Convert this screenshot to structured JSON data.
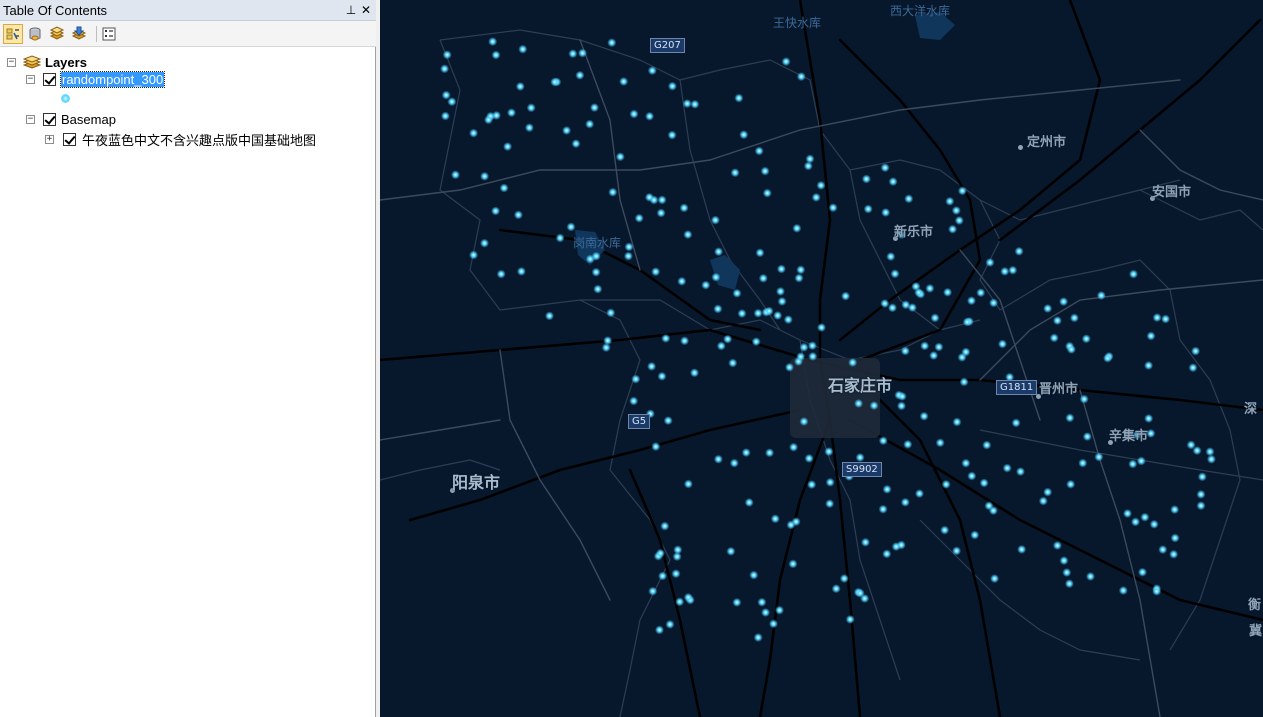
{
  "toc": {
    "title": "Table Of Contents",
    "pin_glyph": "⊥",
    "close_glyph": "✕",
    "toolbar": [
      {
        "name": "list-by-drawing-order-icon"
      },
      {
        "name": "list-by-source-icon"
      },
      {
        "name": "list-by-visibility-icon"
      },
      {
        "name": "list-by-selection-icon"
      },
      {
        "name": "options-icon"
      }
    ],
    "tree": {
      "root_label": "Layers",
      "layer_label": "randompoint_300",
      "group_label": "Basemap",
      "basemap_label": "午夜蓝色中文不含兴趣点版中国基础地图"
    }
  },
  "map": {
    "background": "#08182c",
    "point_color": "#53d4ff",
    "labels": {
      "wangkuai": "王快水库",
      "xidayang": "西大洋水库",
      "dingzhou": "定州市",
      "anguo": "安国市",
      "xinle": "新乐市",
      "gangnan": "岗南水库",
      "shijiazhuang": "石家庄市",
      "jinzhou": "晋州市",
      "xinji": "辛集市",
      "yangquan": "阳泉市",
      "shen": "深",
      "heng": "衡",
      "ji": "冀"
    },
    "shields": {
      "g207": "G207",
      "g5": "G5",
      "g1811": "G1811",
      "s9902": "S9902"
    }
  }
}
